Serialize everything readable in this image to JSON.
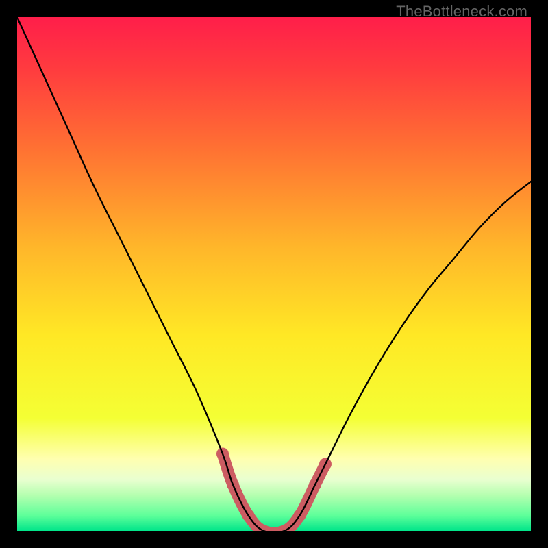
{
  "watermark": "TheBottleneck.com",
  "chart_data": {
    "type": "line",
    "title": "",
    "xlabel": "",
    "ylabel": "",
    "xlim": [
      0,
      100
    ],
    "ylim": [
      0,
      100
    ],
    "grid": false,
    "legend": false,
    "series": [
      {
        "name": "primary-curve",
        "x": [
          0,
          5,
          10,
          15,
          20,
          25,
          30,
          35,
          40,
          42,
          45,
          48,
          52,
          55,
          58,
          60,
          65,
          70,
          75,
          80,
          85,
          90,
          95,
          100
        ],
        "y": [
          100,
          89,
          78,
          67,
          57,
          47,
          37,
          27,
          15,
          9,
          3,
          0,
          0,
          3,
          9,
          13,
          23,
          32,
          40,
          47,
          53,
          59,
          64,
          68
        ]
      },
      {
        "name": "highlight-segment",
        "x": [
          40,
          42,
          45,
          48,
          52,
          55,
          58,
          60
        ],
        "y": [
          15,
          9,
          3,
          0,
          0,
          3,
          9,
          13
        ]
      }
    ],
    "gradient_stops": [
      {
        "offset": 0.0,
        "color": "#ff1e4a"
      },
      {
        "offset": 0.1,
        "color": "#ff3b3f"
      },
      {
        "offset": 0.25,
        "color": "#ff6f33"
      },
      {
        "offset": 0.45,
        "color": "#ffb72a"
      },
      {
        "offset": 0.62,
        "color": "#ffe825"
      },
      {
        "offset": 0.78,
        "color": "#f4ff34"
      },
      {
        "offset": 0.86,
        "color": "#ffffb0"
      },
      {
        "offset": 0.9,
        "color": "#e9ffd0"
      },
      {
        "offset": 0.93,
        "color": "#b6ffb0"
      },
      {
        "offset": 0.97,
        "color": "#5eff9a"
      },
      {
        "offset": 1.0,
        "color": "#00e58a"
      }
    ],
    "highlight_color": "#cc5c62",
    "curve_color": "#000000"
  }
}
